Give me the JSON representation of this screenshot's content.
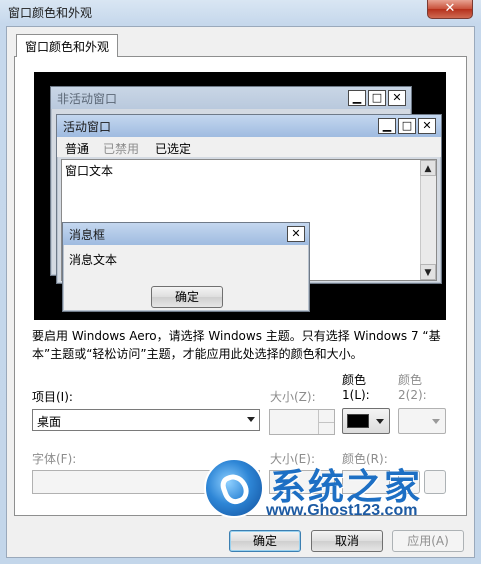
{
  "window": {
    "title": "窗口颜色和外观",
    "close_glyph": "✕"
  },
  "tab": {
    "label": "窗口颜色和外观"
  },
  "preview": {
    "inactive_window_title": "非活动窗口",
    "active_window_title": "活动窗口",
    "menu": {
      "normal": "普通",
      "disabled": "已禁用",
      "selected": "已选定"
    },
    "window_text": "窗口文本",
    "message_box": {
      "title": "消息框",
      "text": "消息文本",
      "ok_label": "确定"
    },
    "caption_glyphs": {
      "minimize": "▁",
      "maximize": "□",
      "close": "✕"
    },
    "scroll_glyphs": {
      "up": "▲",
      "down": "▼"
    }
  },
  "description": {
    "line1": "要启用 Windows Aero，请选择 Windows 主题。只有选择 Windows 7 “基",
    "line2": "本”主题或“轻松访问”主题，才能应用此处选择的颜色和大小。"
  },
  "item": {
    "label": "项目(I):",
    "value": "桌面",
    "size_label": "大小(Z):",
    "color1_label_a": "颜色",
    "color1_label_b": "1(L):",
    "color2_label_a": "颜色",
    "color2_label_b": "2(2):",
    "color1_value": "#000000"
  },
  "font": {
    "label": "字体(F):",
    "size_label": "大小(E):",
    "color_label": "颜色(R):"
  },
  "buttons": {
    "ok": "确定",
    "cancel": "取消",
    "apply": "应用(A)"
  },
  "watermark": {
    "brand": "系统之家",
    "url": "www.Ghost123.com"
  }
}
